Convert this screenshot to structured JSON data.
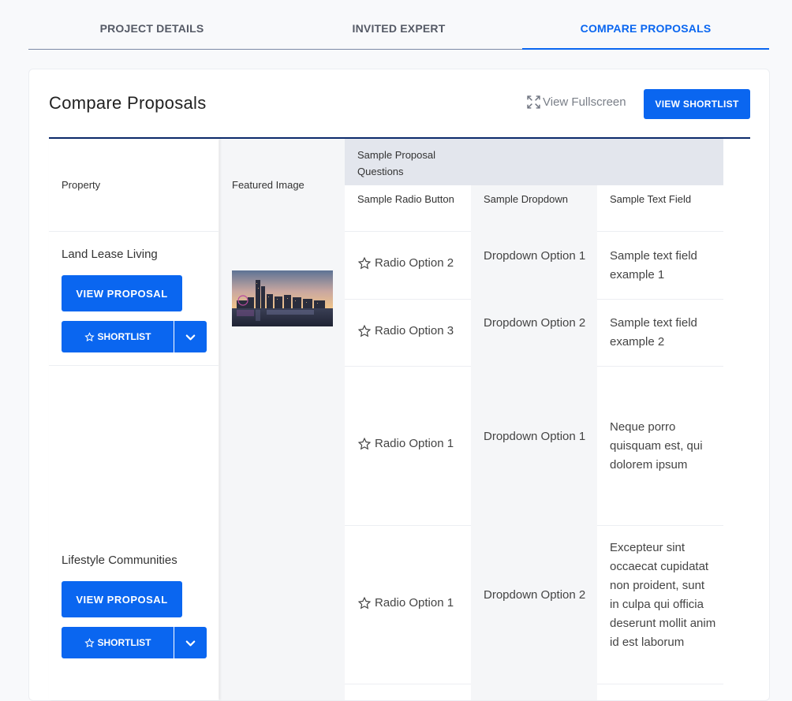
{
  "tabs": [
    {
      "label": "PROJECT DETAILS"
    },
    {
      "label": "INVITED EXPERT"
    },
    {
      "label": "COMPARE PROPOSALS"
    }
  ],
  "page": {
    "title": "Compare Proposals",
    "fullscreen_label": "View Fullscreen",
    "shortlist_button": "VIEW SHORTLIST"
  },
  "table": {
    "headers": {
      "property": "Property",
      "featured_image": "Featured Image",
      "group": "Sample Proposal Questions",
      "radio": "Sample Radio Button",
      "dropdown": "Sample Dropdown",
      "text": "Sample Text Field"
    },
    "properties": [
      {
        "name": "Land Lease Living",
        "view_label": "VIEW PROPOSAL",
        "shortlist_label": "SHORTLIST"
      },
      {
        "name": "Lifestyle Communities",
        "view_label": "VIEW PROPOSAL",
        "shortlist_label": "SHORTLIST"
      }
    ],
    "rows": [
      {
        "radio": "Radio Option 2",
        "dropdown": "Dropdown Option 1",
        "text": "Sample text field example 1"
      },
      {
        "radio": "Radio Option 3",
        "dropdown": "Dropdown Option 2",
        "text": "Sample text field example 2"
      },
      {
        "radio": "Radio Option 1",
        "dropdown": "Dropdown Option 1",
        "text": "Neque porro quisquam est, qui dolorem ipsum"
      },
      {
        "radio": "Radio Option 1",
        "dropdown": "Dropdown Option 2",
        "text": "Excepteur sint occaecat cupidatat non proident, sunt in culpa qui officia deserunt mollit anim id est laborum"
      }
    ]
  },
  "colors": {
    "accent": "#0a66f0",
    "rule": "#0c2a6b",
    "header_bg": "#e3e6ed"
  }
}
